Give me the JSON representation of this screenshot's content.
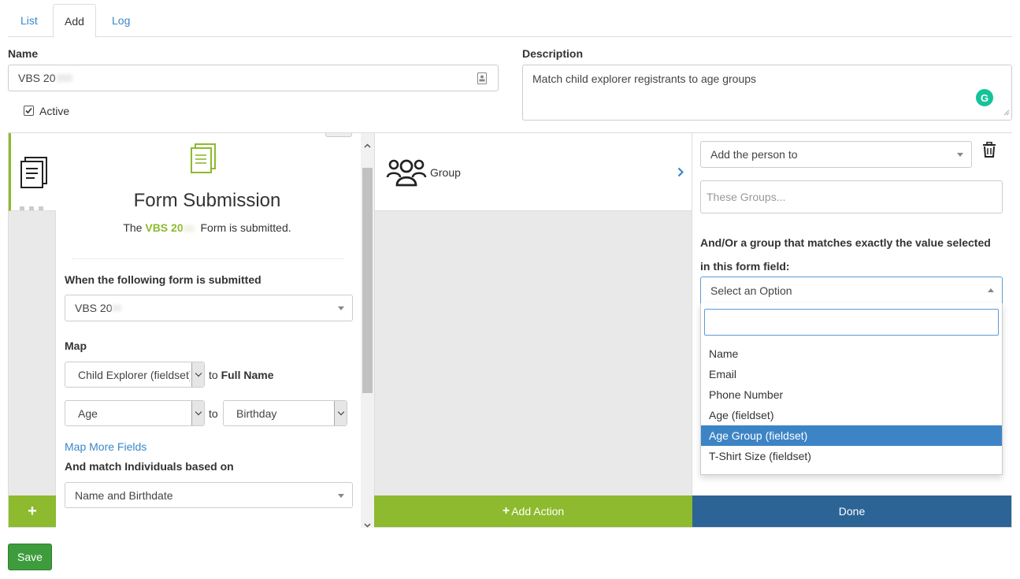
{
  "tabs": [
    {
      "label": "List"
    },
    {
      "label": "Add"
    },
    {
      "label": "Log"
    }
  ],
  "form": {
    "name_label": "Name",
    "name_value": "VBS 20",
    "active_label": "Active",
    "description_label": "Description",
    "description_value": "Match child explorer registrants to age groups"
  },
  "trigger": {
    "title": "Form Submission",
    "summary_prefix": "The",
    "summary_form": "VBS 20",
    "summary_suffix": "Form is submitted.",
    "form_label": "When the following form is submitted",
    "form_value": "VBS 20",
    "map_label": "Map",
    "map_rows": [
      {
        "from": "Child Explorer (fieldset)",
        "to_word": "to",
        "to": "Full Name"
      },
      {
        "from": "Age",
        "to_word": "to",
        "to": "Birthday"
      }
    ],
    "map_more_link": "Map More Fields",
    "match_label": "And match Individuals based on",
    "match_value": "Name and Birthdate"
  },
  "action": {
    "label": "Group",
    "add_action_label": "Add Action",
    "done_label": "Done"
  },
  "settings": {
    "add_person_value": "Add the person to",
    "groups_placeholder": "These Groups...",
    "match_group_text_1": "And/Or a group that matches exactly the value selected",
    "match_group_text_2": "in this form field:",
    "select_value": "Select an Option",
    "options": [
      "Name",
      "Email",
      "Phone Number",
      "Age (fieldset)",
      "Age Group (fieldset)",
      "T-Shirt Size (fieldset)"
    ],
    "selected_option": "Age Group (fieldset)"
  },
  "footer": {
    "save_label": "Save",
    "add_trigger_label": "+"
  },
  "colors": {
    "accent_green": "#8dba2e",
    "done_blue": "#2c6496",
    "link_blue": "#3a87c8",
    "highlight_blue": "#3c84c5",
    "save_green": "#3e9c3c"
  }
}
